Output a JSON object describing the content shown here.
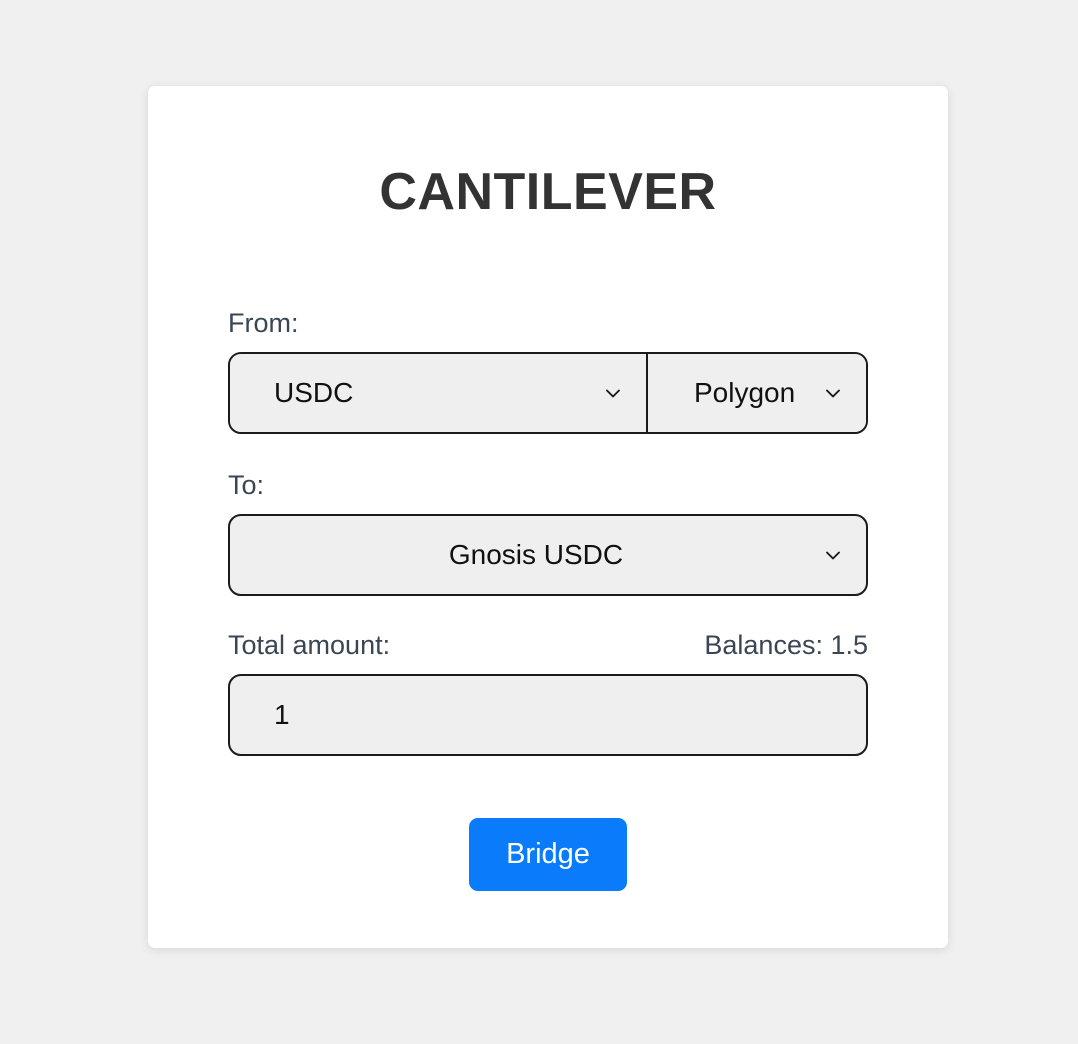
{
  "app": {
    "title": "CANTILEVER",
    "accent_color": "#0a7cfb",
    "page_background": "#f0f0f0",
    "card_background": "#ffffff",
    "field_background": "#efefef",
    "field_border_color": "#1b1b1b",
    "label_color": "#3a4653"
  },
  "form": {
    "from": {
      "label": "From:",
      "asset": {
        "value": "USDC",
        "icon": "chevron-down-icon"
      },
      "chain": {
        "value": "Polygon",
        "icon": "chevron-down-icon"
      }
    },
    "to": {
      "label": "To:",
      "asset": {
        "value": "Gnosis USDC",
        "icon": "chevron-down-icon"
      }
    },
    "amount": {
      "label": "Total amount:",
      "balances_label": "Balances: 1.5",
      "value": "1",
      "placeholder": "0"
    },
    "submit": {
      "label": "Bridge"
    }
  }
}
